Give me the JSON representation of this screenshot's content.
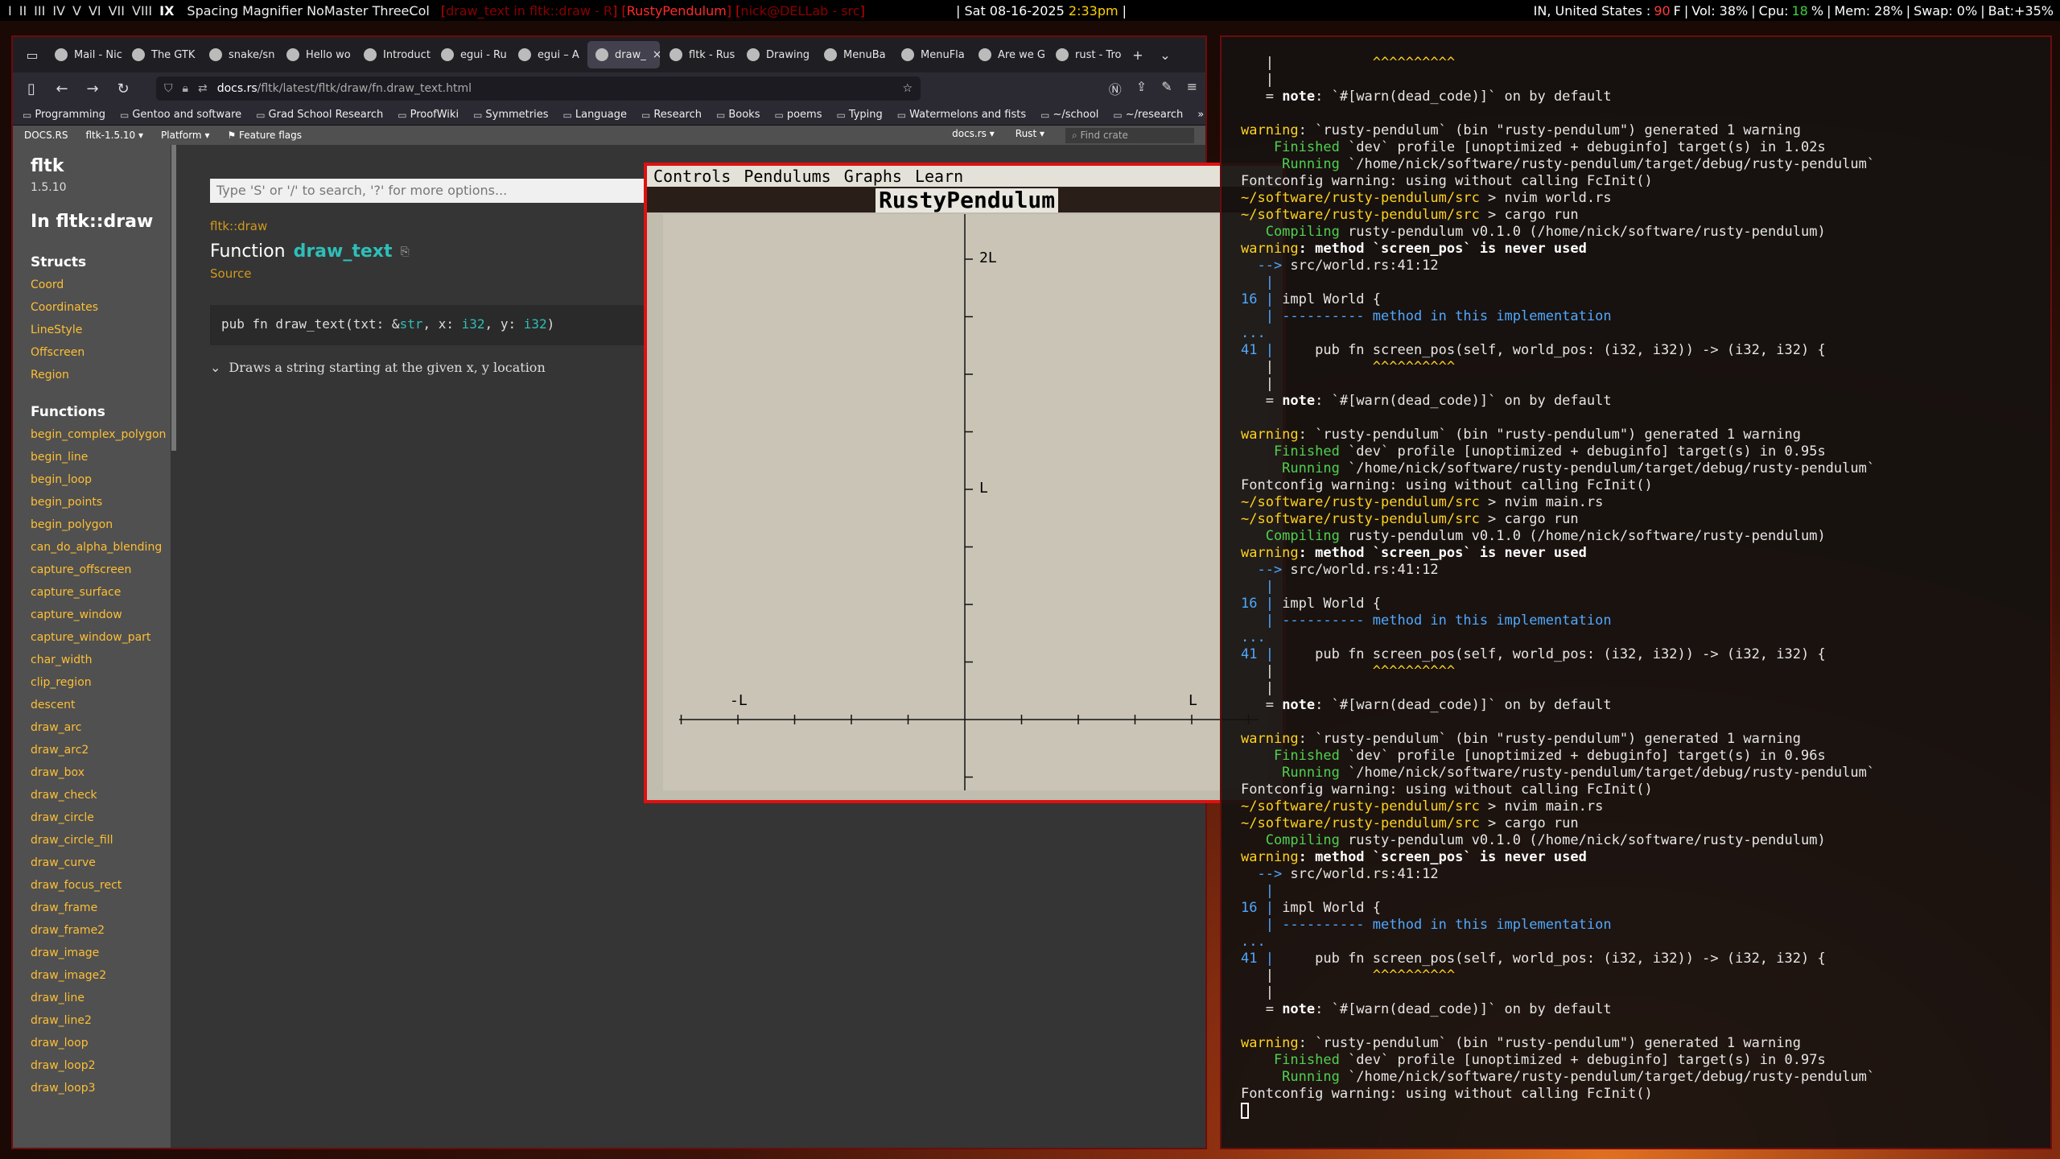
{
  "statusbar": {
    "workspaces": [
      "I",
      "II",
      "III",
      "IV",
      "V",
      "VI",
      "VII",
      "VIII",
      "IX"
    ],
    "layout": "Spacing Magnifier NoMaster ThreeCol",
    "win_prev": "draw_text in fltk::draw - R",
    "win_current": "RustyPendulum",
    "win_next": "nick@DELLab - src",
    "date": "Sat 08-16-2025",
    "time": "2:33pm",
    "location": "IN, United States :",
    "temp": "90",
    "temp_unit": "F",
    "vol": "Vol: 38%",
    "cpu_label": "Cpu:",
    "cpu_val": "18",
    "cpu_pct": "%",
    "mem": "Mem: 28%",
    "swap": "Swap: 0%",
    "bat": "Bat:+35%"
  },
  "browser": {
    "tabs": [
      {
        "label": "Mail - Nic",
        "icon": "mail-icon"
      },
      {
        "label": "The GTK",
        "icon": "gtk-icon"
      },
      {
        "label": "snake/sn",
        "icon": "snake-icon"
      },
      {
        "label": "Hello wo",
        "icon": "book-icon"
      },
      {
        "label": "Introduct",
        "icon": "rust-icon"
      },
      {
        "label": "egui - Ru",
        "icon": "docsrs-icon"
      },
      {
        "label": "egui – A",
        "icon": "egui-icon"
      },
      {
        "label": "draw_",
        "icon": "docsrs-icon"
      },
      {
        "label": "fltk - Rus",
        "icon": "docsrs-icon"
      },
      {
        "label": "Drawing",
        "icon": "book-icon"
      },
      {
        "label": "MenuBa",
        "icon": "docsrs-icon"
      },
      {
        "label": "MenuFla",
        "icon": "docsrs-icon"
      },
      {
        "label": "Are we G",
        "icon": "docsrs-icon"
      },
      {
        "label": "rust - Tro",
        "icon": "rust-icon"
      }
    ],
    "url_host": "docs.rs",
    "url_path": "/fltk/latest/fltk/draw/fn.draw_text.html",
    "bookmarks": [
      "Programming",
      "Gentoo and software",
      "Grad School Research",
      "ProofWiki",
      "Symmetries",
      "Language",
      "Research",
      "Books",
      "poems",
      "Typing",
      "Watermelons and fists",
      "~/school",
      "~/research"
    ],
    "docsbar": {
      "logo": "DOCS.RS",
      "crate": "fltk-1.5.10",
      "platform": "Platform",
      "flags": "Feature flags",
      "docsrs_menu": "docs.rs",
      "rust_menu": "Rust",
      "find_placeholder": "Find crate"
    }
  },
  "docs": {
    "crate": "fltk",
    "version": "1.5.10",
    "in_module": "In fltk::draw",
    "structs_heading": "Structs",
    "structs": [
      "Coord",
      "Coordinates",
      "LineStyle",
      "Offscreen",
      "Region"
    ],
    "functions_heading": "Functions",
    "functions": [
      "begin_complex_polygon",
      "begin_line",
      "begin_loop",
      "begin_points",
      "begin_polygon",
      "can_do_alpha_blending",
      "capture_offscreen",
      "capture_surface",
      "capture_window",
      "capture_window_part",
      "char_width",
      "clip_region",
      "descent",
      "draw_arc",
      "draw_arc2",
      "draw_box",
      "draw_check",
      "draw_circle",
      "draw_circle_fill",
      "draw_curve",
      "draw_focus_rect",
      "draw_frame",
      "draw_frame2",
      "draw_image",
      "draw_image2",
      "draw_line",
      "draw_line2",
      "draw_loop",
      "draw_loop2",
      "draw_loop3"
    ],
    "search_placeholder": "Type 'S' or '/' to search, '?' for more options...",
    "breadcrumb": "fltk::draw",
    "title_prefix": "Function",
    "title_name": "draw_text",
    "source": "Source",
    "sig_pre": "pub fn draw_text(txt: &",
    "sig_str": "str",
    "sig_mid1": ", x: ",
    "sig_i32a": "i32",
    "sig_mid2": ", y: ",
    "sig_i32b": "i32",
    "sig_end": ")",
    "description": "Draws a string starting at the given x, y location"
  },
  "fltk": {
    "menus": [
      "Controls",
      "Pendulums",
      "Graphs",
      "Learn"
    ],
    "title": "RustyPendulum",
    "chart_data": {
      "type": "scatter",
      "x_tick_labels": [
        "-L",
        "L"
      ],
      "y_tick_labels": [
        "2L",
        "L"
      ],
      "xlim": [
        -1.0,
        1.0
      ],
      "ylim": [
        0,
        2.0
      ],
      "series": []
    }
  },
  "terminal": {
    "lines": [
      [
        {
          "t": "   |            "
        },
        {
          "t": "^^^^^^^^^^",
          "c": "c-y"
        }
      ],
      [
        {
          "t": "   |"
        }
      ],
      [
        {
          "t": "   = "
        },
        {
          "t": "note",
          "c": "c-w"
        },
        {
          "t": ": `#[warn(dead_code)]` on by default"
        }
      ],
      [
        {
          "t": ""
        }
      ],
      [
        {
          "t": "warning",
          "c": "c-y"
        },
        {
          "t": ": `rusty-pendulum` (bin \"rusty-pendulum\") generated 1 warning"
        }
      ],
      [
        {
          "t": "    Finished",
          "c": "c-g"
        },
        {
          "t": " `dev` profile [unoptimized + debuginfo] target(s) in 1.02s"
        }
      ],
      [
        {
          "t": "     Running",
          "c": "c-g"
        },
        {
          "t": " `/home/nick/software/rusty-pendulum/target/debug/rusty-pendulum`"
        }
      ],
      [
        {
          "t": "Fontconfig warning: using without calling FcInit()"
        }
      ],
      [
        {
          "t": "~/software/rusty-pendulum/src",
          "c": "c-y"
        },
        {
          "t": " > nvim world.rs"
        }
      ],
      [
        {
          "t": "~/software/rusty-pendulum/src",
          "c": "c-y"
        },
        {
          "t": " > cargo run"
        }
      ],
      [
        {
          "t": "   Compiling",
          "c": "c-g"
        },
        {
          "t": " rusty-pendulum v0.1.0 (/home/nick/software/rusty-pendulum)"
        }
      ],
      [
        {
          "t": "warning",
          "c": "c-y"
        },
        {
          "t": ": method `screen_pos` is never used",
          "c": "c-w"
        }
      ],
      [
        {
          "t": "  --> ",
          "c": "c-b"
        },
        {
          "t": "src/world.rs:41:12"
        }
      ],
      [
        {
          "t": "   |",
          "c": "c-b"
        }
      ],
      [
        {
          "t": "16 |",
          "c": "c-b"
        },
        {
          "t": " impl World {"
        }
      ],
      [
        {
          "t": "   |",
          "c": "c-b"
        },
        {
          "t": " ---------- method in this implementation",
          "c": "c-b"
        }
      ],
      [
        {
          "t": "...",
          "c": "c-b"
        }
      ],
      [
        {
          "t": "41 |",
          "c": "c-b"
        },
        {
          "t": "     pub fn screen_pos(self, world_pos: (i32, i32)) -> (i32, i32) {"
        }
      ],
      [
        {
          "t": "   |            "
        },
        {
          "t": "^^^^^^^^^^",
          "c": "c-y"
        }
      ],
      [
        {
          "t": "   |"
        }
      ],
      [
        {
          "t": "   = "
        },
        {
          "t": "note",
          "c": "c-w"
        },
        {
          "t": ": `#[warn(dead_code)]` on by default"
        }
      ],
      [
        {
          "t": ""
        }
      ],
      [
        {
          "t": "warning",
          "c": "c-y"
        },
        {
          "t": ": `rusty-pendulum` (bin \"rusty-pendulum\") generated 1 warning"
        }
      ],
      [
        {
          "t": "    Finished",
          "c": "c-g"
        },
        {
          "t": " `dev` profile [unoptimized + debuginfo] target(s) in 0.95s"
        }
      ],
      [
        {
          "t": "     Running",
          "c": "c-g"
        },
        {
          "t": " `/home/nick/software/rusty-pendulum/target/debug/rusty-pendulum`"
        }
      ],
      [
        {
          "t": "Fontconfig warning: using without calling FcInit()"
        }
      ],
      [
        {
          "t": "~/software/rusty-pendulum/src",
          "c": "c-y"
        },
        {
          "t": " > nvim main.rs"
        }
      ],
      [
        {
          "t": "~/software/rusty-pendulum/src",
          "c": "c-y"
        },
        {
          "t": " > cargo run"
        }
      ],
      [
        {
          "t": "   Compiling",
          "c": "c-g"
        },
        {
          "t": " rusty-pendulum v0.1.0 (/home/nick/software/rusty-pendulum)"
        }
      ],
      [
        {
          "t": "warning",
          "c": "c-y"
        },
        {
          "t": ": method `screen_pos` is never used",
          "c": "c-w"
        }
      ],
      [
        {
          "t": "  --> ",
          "c": "c-b"
        },
        {
          "t": "src/world.rs:41:12"
        }
      ],
      [
        {
          "t": "   |",
          "c": "c-b"
        }
      ],
      [
        {
          "t": "16 |",
          "c": "c-b"
        },
        {
          "t": " impl World {"
        }
      ],
      [
        {
          "t": "   |",
          "c": "c-b"
        },
        {
          "t": " ---------- method in this implementation",
          "c": "c-b"
        }
      ],
      [
        {
          "t": "...",
          "c": "c-b"
        }
      ],
      [
        {
          "t": "41 |",
          "c": "c-b"
        },
        {
          "t": "     pub fn screen_pos(self, world_pos: (i32, i32)) -> (i32, i32) {"
        }
      ],
      [
        {
          "t": "   |            "
        },
        {
          "t": "^^^^^^^^^^",
          "c": "c-y"
        }
      ],
      [
        {
          "t": "   |"
        }
      ],
      [
        {
          "t": "   = "
        },
        {
          "t": "note",
          "c": "c-w"
        },
        {
          "t": ": `#[warn(dead_code)]` on by default"
        }
      ],
      [
        {
          "t": ""
        }
      ],
      [
        {
          "t": "warning",
          "c": "c-y"
        },
        {
          "t": ": `rusty-pendulum` (bin \"rusty-pendulum\") generated 1 warning"
        }
      ],
      [
        {
          "t": "    Finished",
          "c": "c-g"
        },
        {
          "t": " `dev` profile [unoptimized + debuginfo] target(s) in 0.96s"
        }
      ],
      [
        {
          "t": "     Running",
          "c": "c-g"
        },
        {
          "t": " `/home/nick/software/rusty-pendulum/target/debug/rusty-pendulum`"
        }
      ],
      [
        {
          "t": "Fontconfig warning: using without calling FcInit()"
        }
      ],
      [
        {
          "t": "~/software/rusty-pendulum/src",
          "c": "c-y"
        },
        {
          "t": " > nvim main.rs"
        }
      ],
      [
        {
          "t": "~/software/rusty-pendulum/src",
          "c": "c-y"
        },
        {
          "t": " > cargo run"
        }
      ],
      [
        {
          "t": "   Compiling",
          "c": "c-g"
        },
        {
          "t": " rusty-pendulum v0.1.0 (/home/nick/software/rusty-pendulum)"
        }
      ],
      [
        {
          "t": "warning",
          "c": "c-y"
        },
        {
          "t": ": method `screen_pos` is never used",
          "c": "c-w"
        }
      ],
      [
        {
          "t": "  --> ",
          "c": "c-b"
        },
        {
          "t": "src/world.rs:41:12"
        }
      ],
      [
        {
          "t": "   |",
          "c": "c-b"
        }
      ],
      [
        {
          "t": "16 |",
          "c": "c-b"
        },
        {
          "t": " impl World {"
        }
      ],
      [
        {
          "t": "   |",
          "c": "c-b"
        },
        {
          "t": " ---------- method in this implementation",
          "c": "c-b"
        }
      ],
      [
        {
          "t": "...",
          "c": "c-b"
        }
      ],
      [
        {
          "t": "41 |",
          "c": "c-b"
        },
        {
          "t": "     pub fn screen_pos(self, world_pos: (i32, i32)) -> (i32, i32) {"
        }
      ],
      [
        {
          "t": "   |            "
        },
        {
          "t": "^^^^^^^^^^",
          "c": "c-y"
        }
      ],
      [
        {
          "t": "   |"
        }
      ],
      [
        {
          "t": "   = "
        },
        {
          "t": "note",
          "c": "c-w"
        },
        {
          "t": ": `#[warn(dead_code)]` on by default"
        }
      ],
      [
        {
          "t": ""
        }
      ],
      [
        {
          "t": "warning",
          "c": "c-y"
        },
        {
          "t": ": `rusty-pendulum` (bin \"rusty-pendulum\") generated 1 warning"
        }
      ],
      [
        {
          "t": "    Finished",
          "c": "c-g"
        },
        {
          "t": " `dev` profile [unoptimized + debuginfo] target(s) in 0.97s"
        }
      ],
      [
        {
          "t": "     Running",
          "c": "c-g"
        },
        {
          "t": " `/home/nick/software/rusty-pendulum/target/debug/rusty-pendulum`"
        }
      ],
      [
        {
          "t": "Fontconfig warning: using without calling FcInit()"
        }
      ]
    ]
  }
}
